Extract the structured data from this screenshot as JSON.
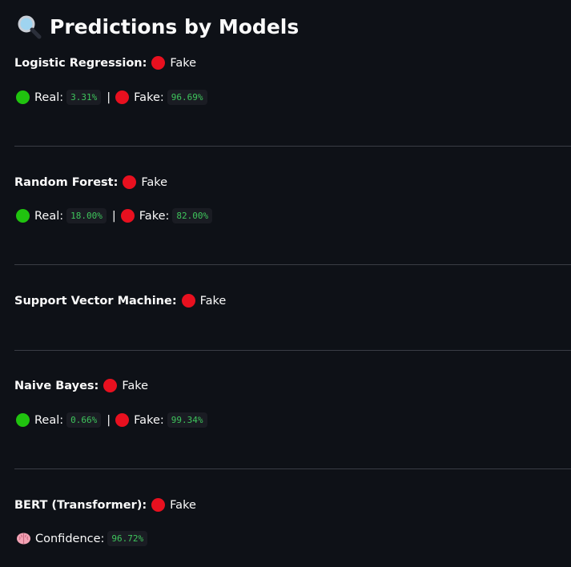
{
  "title": "Predictions by Models",
  "models": [
    {
      "name": "Logistic Regression:",
      "prediction": "Fake",
      "real_label": "Real:",
      "real_value": "3.31%",
      "fake_label": "Fake:",
      "fake_value": "96.69%",
      "separator": "|"
    },
    {
      "name": "Random Forest:",
      "prediction": "Fake",
      "real_label": "Real:",
      "real_value": "18.00%",
      "fake_label": "Fake:",
      "fake_value": "82.00%",
      "separator": "|"
    },
    {
      "name": "Support Vector Machine:",
      "prediction": "Fake"
    },
    {
      "name": "Naive Bayes:",
      "prediction": "Fake",
      "real_label": "Real:",
      "real_value": "0.66%",
      "fake_label": "Fake:",
      "fake_value": "99.34%",
      "separator": "|"
    },
    {
      "name": "BERT (Transformer):",
      "prediction": "Fake",
      "confidence_label": "Confidence:",
      "confidence_value": "96.72%"
    }
  ],
  "icons": {
    "title": "magnifying-glass-icon",
    "confidence": "brain-icon",
    "real": "green-circle",
    "fake": "red-circle"
  },
  "colors": {
    "background": "#0e1117",
    "fake_dot": "#e8101f",
    "real_dot": "#20c30f",
    "code_text": "#3ec55c",
    "divider": "#3a3d45"
  }
}
